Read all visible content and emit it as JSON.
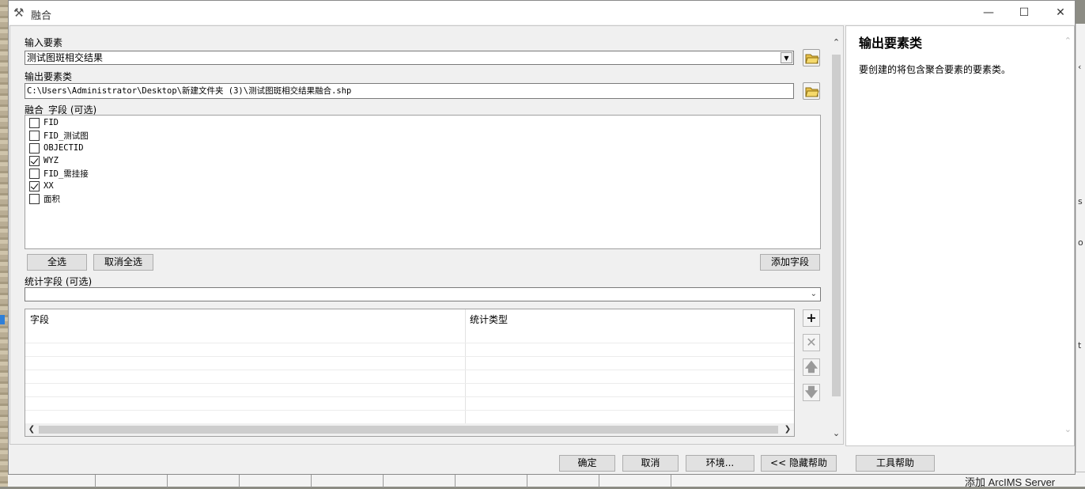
{
  "window": {
    "title": "融合",
    "minimize": "—",
    "maximize": "☐",
    "close": "✕"
  },
  "input_features": {
    "label": "输入要素",
    "value": "测试图斑相交结果"
  },
  "output_feature_class": {
    "label": "输出要素类",
    "value": "C:\\Users\\Administrator\\Desktop\\新建文件夹 (3)\\测试图斑相交结果融合.shp"
  },
  "dissolve_fields": {
    "label": "融合_字段 (可选)",
    "items": [
      {
        "label": "FID",
        "checked": false
      },
      {
        "label": "FID_测试图",
        "checked": false
      },
      {
        "label": "OBJECTID",
        "checked": false
      },
      {
        "label": "WYZ",
        "checked": true
      },
      {
        "label": "FID_需挂接",
        "checked": false
      },
      {
        "label": "XX",
        "checked": true
      },
      {
        "label": "面积",
        "checked": false
      }
    ],
    "select_all": "全选",
    "unselect_all": "取消全选",
    "add_field": "添加字段"
  },
  "statistics_fields": {
    "label": "统计字段 (可选)",
    "value": "",
    "columns": [
      "字段",
      "统计类型"
    ]
  },
  "help_panel": {
    "title": "输出要素类",
    "description": "要创建的将包含聚合要素的要素类。"
  },
  "footer": {
    "ok": "确定",
    "cancel": "取消",
    "environments": "环境...",
    "hide_help": "<< 隐藏帮助",
    "tool_help": "工具帮助"
  },
  "background": {
    "taskbar_text": "添加 ArcIMS Server"
  }
}
